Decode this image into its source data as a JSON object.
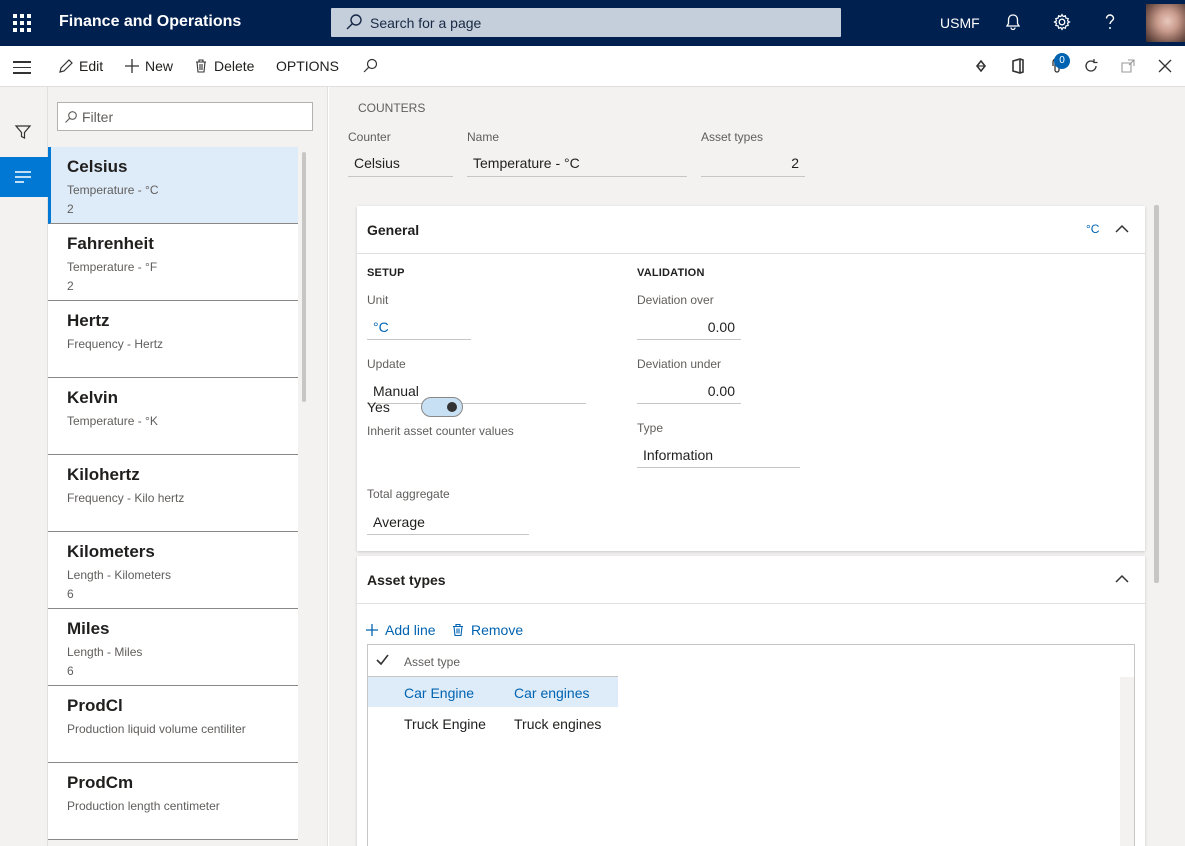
{
  "app": {
    "title": "Finance and Operations",
    "company": "USMF"
  },
  "search": {
    "placeholder": "Search for a page"
  },
  "actions": {
    "edit": "Edit",
    "new": "New",
    "delete": "Delete",
    "options": "OPTIONS",
    "attachments_count": "0"
  },
  "filter": {
    "placeholder": "Filter"
  },
  "list": {
    "items": [
      {
        "title": "Celsius",
        "subtitle": "Temperature - °C",
        "count": "2"
      },
      {
        "title": "Fahrenheit",
        "subtitle": "Temperature - °F",
        "count": "2"
      },
      {
        "title": "Hertz",
        "subtitle": "Frequency - Hertz",
        "count": ""
      },
      {
        "title": "Kelvin",
        "subtitle": "Temperature - °K",
        "count": ""
      },
      {
        "title": "Kilohertz",
        "subtitle": "Frequency - Kilo hertz",
        "count": ""
      },
      {
        "title": "Kilometers",
        "subtitle": "Length - Kilometers",
        "count": "6"
      },
      {
        "title": "Miles",
        "subtitle": "Length - Miles",
        "count": "6"
      },
      {
        "title": "ProdCl",
        "subtitle": "Production liquid volume centiliter",
        "count": ""
      },
      {
        "title": "ProdCm",
        "subtitle": "Production length centimeter",
        "count": ""
      }
    ]
  },
  "header": {
    "caption": "COUNTERS",
    "counter_label": "Counter",
    "counter_value": "Celsius",
    "name_label": "Name",
    "name_value": "Temperature - °C",
    "asset_types_label": "Asset types",
    "asset_types_value": "2"
  },
  "general": {
    "title": "General",
    "summary": "°C",
    "setup_title": "SETUP",
    "validation_title": "VALIDATION",
    "unit_label": "Unit",
    "unit_value": "°C",
    "update_label": "Update",
    "update_value": "Manual",
    "inherit_label": "Inherit asset counter values",
    "inherit_value": "Yes",
    "total_label": "Total aggregate",
    "total_value": "Average",
    "dev_over_label": "Deviation over",
    "dev_over_value": "0.00",
    "dev_under_label": "Deviation under",
    "dev_under_value": "0.00",
    "type_label": "Type",
    "type_value": "Information"
  },
  "asset_types": {
    "title": "Asset types",
    "add_line": "Add line",
    "remove": "Remove",
    "column": "Asset type",
    "rows": [
      {
        "type": "Car Engine",
        "name": "Car engines"
      },
      {
        "type": "Truck Engine",
        "name": "Truck engines"
      }
    ]
  },
  "colors": {
    "nav": "#002050",
    "accent": "#0078d4",
    "link": "#0063b1",
    "selected": "#deecf9"
  }
}
